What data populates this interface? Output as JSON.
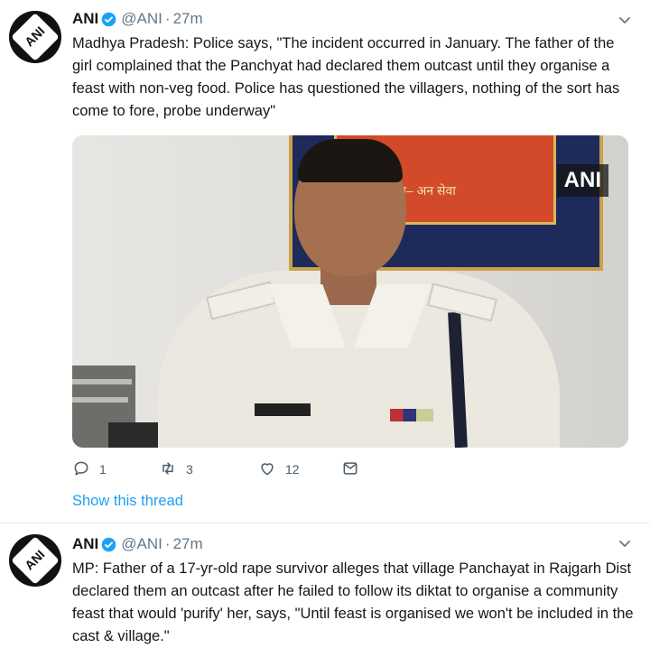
{
  "colors": {
    "link": "#1da1f2",
    "verified": "#1da1f2",
    "muted": "#657786",
    "text": "#14171a"
  },
  "tweets": [
    {
      "avatar_text": "ANI",
      "name": "ANI",
      "handle": "@ANI",
      "separator": "·",
      "time": "27m",
      "text": "Madhya Pradesh: Police says, \"The incident occurred in January. The father of the girl complained that the Panchyat had declared them outcast until they organise a feast with non-veg food. Police has questioned the villagers, nothing of the sort has come to fore, probe underway\"",
      "media_watermark": "ANI",
      "media_board_text": "त– अन सेवा",
      "reply_count": "1",
      "retweet_count": "3",
      "like_count": "12",
      "thread_link": "Show this thread",
      "icons": [
        "verified-badge-icon",
        "chevron-down-icon",
        "reply-icon",
        "retweet-icon",
        "like-icon",
        "message-icon"
      ]
    },
    {
      "avatar_text": "ANI",
      "name": "ANI",
      "handle": "@ANI",
      "separator": "·",
      "time": "27m",
      "text": "MP: Father of a 17-yr-old rape survivor alleges that village Panchayat in Rajgarh Dist declared them an outcast after he failed to follow its diktat to organise a community feast that would 'purify' her, says, \"Until feast is organised we won't be included in the cast & village.\"",
      "icons": [
        "verified-badge-icon",
        "chevron-down-icon"
      ]
    }
  ]
}
